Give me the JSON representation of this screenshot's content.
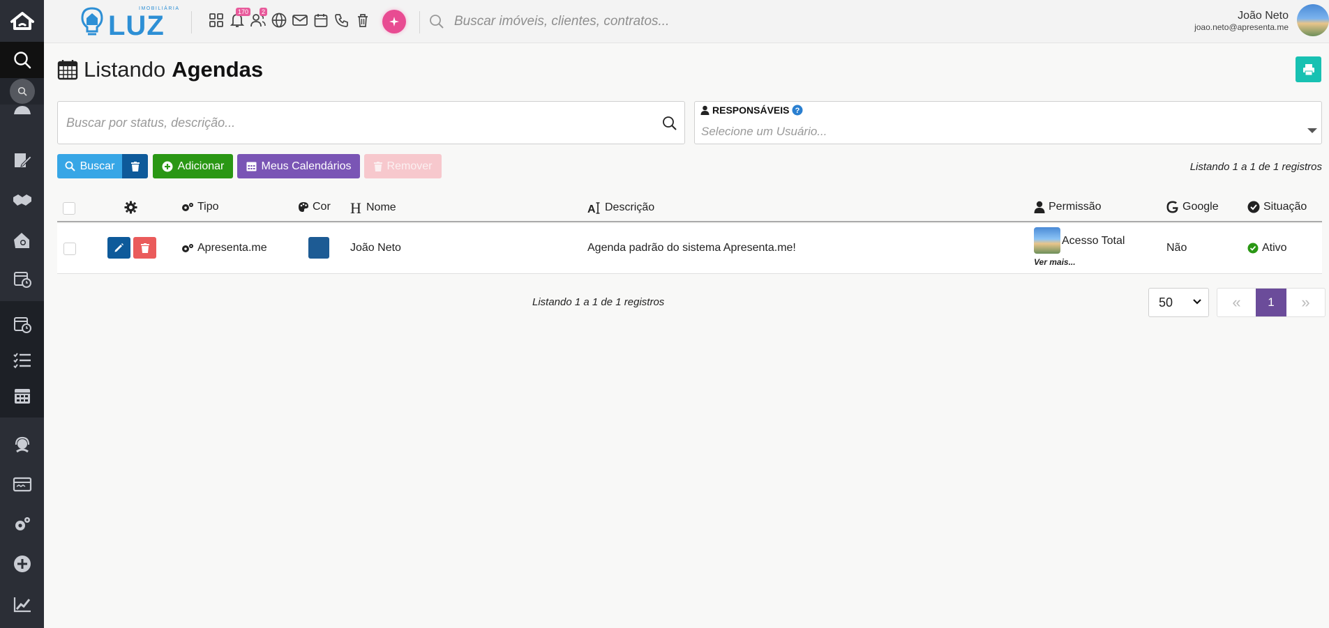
{
  "header": {
    "brand_sub": "IMOBILIÁRIA",
    "brand_name": "LUZ",
    "notifications_count": "170",
    "users_count": "2",
    "search_placeholder": "Buscar imóveis, clientes, contratos...",
    "user_name": "João Neto",
    "user_email": "joao.neto@apresenta.me"
  },
  "page": {
    "title_prefix": "Listando",
    "title_main": "Agendas"
  },
  "filters": {
    "search_placeholder": "Buscar por status, descrição...",
    "responsaveis_label": "RESPONSÁVEIS",
    "responsaveis_placeholder": "Selecione um Usuário..."
  },
  "actions": {
    "buscar": "Buscar",
    "adicionar": "Adicionar",
    "meus_calendarios": "Meus Calendários",
    "remover": "Remover"
  },
  "listing": "Listando 1 a 1 de 1 registros",
  "table": {
    "columns": {
      "tipo": "Tipo",
      "cor": "Cor",
      "nome": "Nome",
      "descricao": "Descrição",
      "permissao": "Permissão",
      "google": "Google",
      "situacao": "Situação"
    },
    "rows": [
      {
        "tipo": "Apresenta.me",
        "cor": "#1d5b94",
        "nome": "João Neto",
        "descricao": "Agenda padrão do sistema Apresenta.me!",
        "permissao": "Acesso Total",
        "ver_mais": "Ver mais...",
        "google": "Não",
        "situacao": "Ativo"
      }
    ]
  },
  "pagination": {
    "per_page": "50",
    "current_page": "1"
  },
  "colors": {
    "sidebar_bg": "#2b2e36",
    "buscar": "#37a6e6",
    "trash": "#0e5a9a",
    "adicionar": "#2a9714",
    "meus_calendarios": "#7a55b5",
    "remover": "#f7c8cd",
    "print": "#18c1b2",
    "active_page": "#6b4c9a",
    "status_active": "#2a9714"
  }
}
